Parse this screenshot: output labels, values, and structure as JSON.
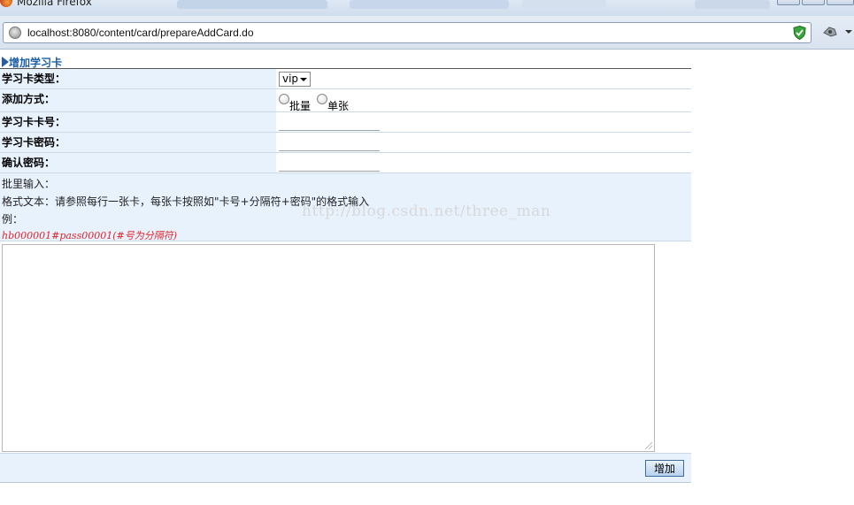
{
  "window": {
    "title": "Mozilla Firefox"
  },
  "browser": {
    "url": "localhost:8080/content/card/prepareAddCard.do",
    "icons": [
      "site-identity-icon",
      "shield-icon",
      "tool-icon",
      "dropdown-arrow-icon"
    ]
  },
  "form": {
    "title": "增加学习卡",
    "card_type": {
      "label": "学习卡类型：",
      "selected": "vip"
    },
    "add_method": {
      "label": "添加方式：",
      "options": [
        "批量",
        "单张"
      ]
    },
    "card_number": {
      "label": "学习卡卡号："
    },
    "card_password": {
      "label": "学习卡密码："
    },
    "confirm_password": {
      "label": "确认密码："
    },
    "batch": {
      "heading": "批里输入：",
      "format_text": "格式文本：请参照每行一张卡，每张卡按照如\"卡号+分隔符+密码\"的格式输入",
      "example_label": "例：",
      "example": "hb000001#pass00001(#号为分隔符)"
    },
    "textarea_value": "",
    "submit_label": "增加"
  },
  "watermark": "http://blog.csdn.net/three_man",
  "colors": {
    "label_bg": "#e8f2fd",
    "title_color": "#1b5fa6",
    "example_color": "#e0242b"
  }
}
